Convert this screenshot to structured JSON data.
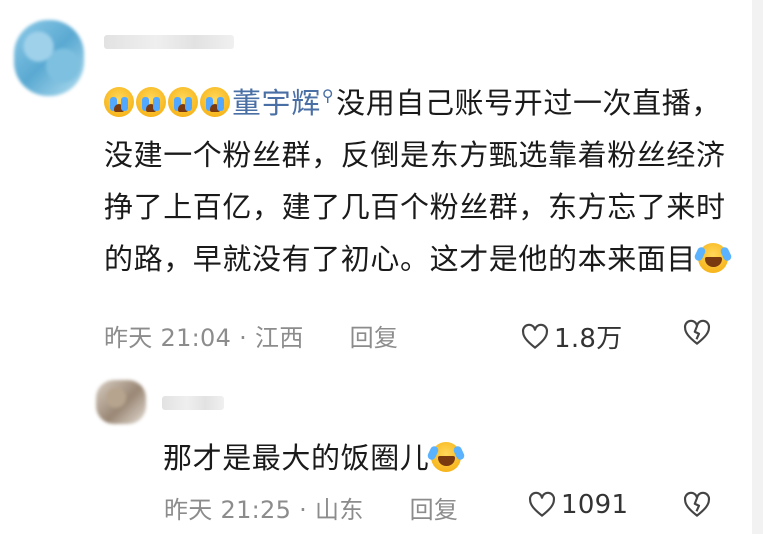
{
  "comment": {
    "text_part1": "没用自己账号开过一次直播，没建一个粉丝群，反倒是东方甄选靠着粉丝经济挣了上百亿，建了几百个粉丝群，东方忘了来时的路，早就没有了初心。这才是他的本来面目",
    "mention": "董宇辉",
    "leading_emojis": [
      "loudly-crying-face",
      "loudly-crying-face",
      "loudly-crying-face",
      "loudly-crying-face"
    ],
    "trailing_emoji": "rolling-on-floor-laughing",
    "time": "昨天 21:04",
    "location": "江西",
    "reply_label": "回复",
    "likes": "1.8万"
  },
  "reply": {
    "text": "那才是最大的饭圈儿",
    "trailing_emoji": "rolling-on-floor-laughing",
    "time": "昨天 21:25",
    "location": "山东",
    "reply_label": "回复",
    "likes": "1091"
  },
  "separator": "·",
  "icons": {
    "like": "heart-outline-icon",
    "dislike": "broken-heart-icon",
    "mention_marker": "search-icon"
  },
  "colors": {
    "text": "#1a1a1a",
    "meta": "#8c8c8c",
    "mention": "#4a6fa5"
  }
}
